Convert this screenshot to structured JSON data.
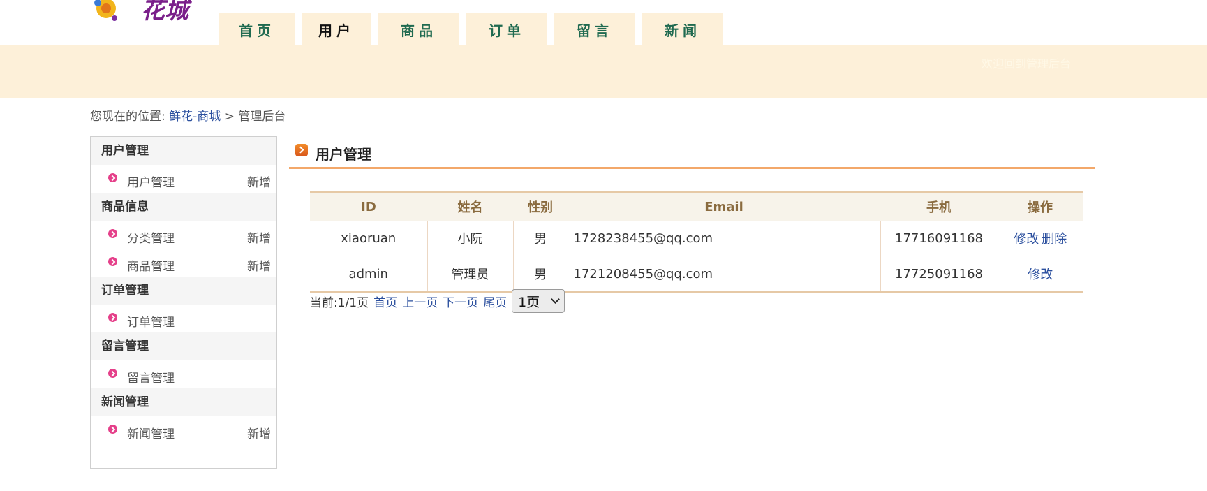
{
  "header": {
    "logo_text": "花城",
    "nav": [
      {
        "label": "首页",
        "active": false
      },
      {
        "label": "用户",
        "active": true
      },
      {
        "label": "商品",
        "active": false
      },
      {
        "label": "订单",
        "active": false
      },
      {
        "label": "留言",
        "active": false
      },
      {
        "label": "新闻",
        "active": false
      }
    ],
    "welcome": "欢迎回到管理后台"
  },
  "breadcrumb": {
    "prefix": "您现在的位置:",
    "home_link": "鲜花-商城",
    "separator": ">",
    "current": "管理后台"
  },
  "sidebar": [
    {
      "title": "用户管理",
      "items": [
        {
          "label": "用户管理",
          "add": "新增"
        }
      ]
    },
    {
      "title": "商品信息",
      "items": [
        {
          "label": "分类管理",
          "add": "新增"
        },
        {
          "label": "商品管理",
          "add": "新增"
        }
      ]
    },
    {
      "title": "订单管理",
      "items": [
        {
          "label": "订单管理",
          "add": ""
        }
      ]
    },
    {
      "title": "留言管理",
      "items": [
        {
          "label": "留言管理",
          "add": ""
        }
      ]
    },
    {
      "title": "新闻管理",
      "items": [
        {
          "label": "新闻管理",
          "add": "新增"
        }
      ]
    }
  ],
  "main": {
    "title": "用户管理",
    "table": {
      "columns": [
        "ID",
        "姓名",
        "性别",
        "Email",
        "手机",
        "操作"
      ],
      "rows": [
        {
          "id": "xiaoruan",
          "name": "小阮",
          "gender": "男",
          "email": "1728238455@qq.com",
          "phone": "17716091168",
          "actions": [
            "修改",
            "删除"
          ]
        },
        {
          "id": "admin",
          "name": "管理员",
          "gender": "男",
          "email": "1721208455@qq.com",
          "phone": "17725091168",
          "actions": [
            "修改"
          ]
        }
      ]
    },
    "pager": {
      "status": "当前:1/1页",
      "first": "首页",
      "prev": "上一页",
      "next": "下一页",
      "last": "尾页",
      "selected": "1页"
    }
  },
  "colors": {
    "banner": "#fdf0d9",
    "nav_text": "#1f6a50",
    "link": "#2b4f9e",
    "accent_line": "#f3a86a",
    "bullet": "#e5408a"
  }
}
